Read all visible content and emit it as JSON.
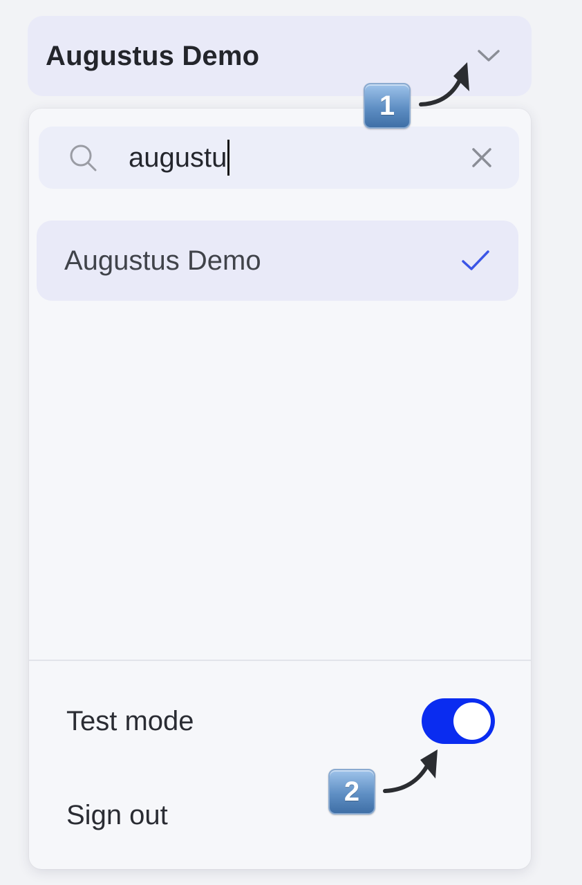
{
  "switcher": {
    "label": "Augustus Demo",
    "icon": "chevron-down-icon"
  },
  "search": {
    "value": "augustu",
    "icon": "search-icon",
    "clear_icon": "close-icon"
  },
  "results": [
    {
      "label": "Augustus Demo",
      "selected": true,
      "icon": "check-icon"
    }
  ],
  "footer": {
    "test_mode_label": "Test mode",
    "test_mode_on": true,
    "sign_out_label": "Sign out"
  },
  "annotations": [
    {
      "label": "1"
    },
    {
      "label": "2"
    }
  ],
  "colors": {
    "accent": "#0a2cf0",
    "check": "#3b55e6",
    "selected_bg": "#e9eaf8",
    "panel_bg": "#f6f7fa"
  }
}
